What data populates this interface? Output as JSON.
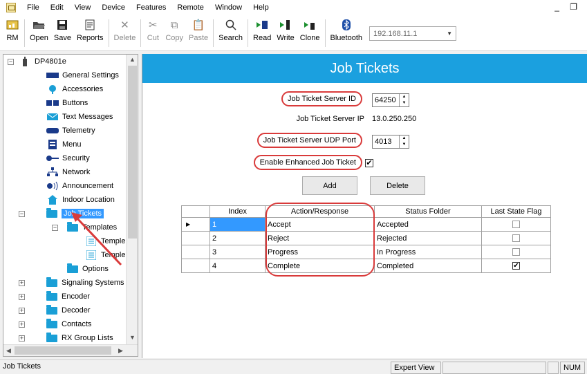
{
  "menu": [
    "File",
    "Edit",
    "View",
    "Device",
    "Features",
    "Remote",
    "Window",
    "Help"
  ],
  "window_controls": "_ ❐",
  "toolbar": {
    "buttons": [
      {
        "label": "RM",
        "icon": "rm-icon"
      },
      {
        "label": "Open",
        "icon": "open-folder-icon"
      },
      {
        "label": "Save",
        "icon": "save-icon"
      },
      {
        "label": "Reports",
        "icon": "reports-icon"
      },
      {
        "label": "Delete",
        "icon": "delete-icon",
        "disabled": true
      },
      {
        "label": "Cut",
        "icon": "cut-icon",
        "disabled": true
      },
      {
        "label": "Copy",
        "icon": "copy-icon",
        "disabled": true
      },
      {
        "label": "Paste",
        "icon": "paste-icon",
        "disabled": true
      },
      {
        "label": "Search",
        "icon": "search-icon"
      },
      {
        "label": "Read",
        "icon": "read-icon"
      },
      {
        "label": "Write",
        "icon": "write-icon"
      },
      {
        "label": "Clone",
        "icon": "clone-icon"
      },
      {
        "label": "Bluetooth",
        "icon": "bluetooth-icon"
      }
    ],
    "ip_address": "192.168.11.1"
  },
  "tree": {
    "root": "DP4801e",
    "items": {
      "general_settings": "General Settings",
      "accessories": "Accessories",
      "buttons": "Buttons",
      "text_messages": "Text Messages",
      "telemetry": "Telemetry",
      "menu": "Menu",
      "security": "Security",
      "network": "Network",
      "announcement": "Announcement",
      "indoor_location": "Indoor Location",
      "job_tickets": "Job Tickets",
      "templates": "Templates",
      "template_1": "Temple",
      "template_2": "Temple",
      "options": "Options",
      "signaling_systems": "Signaling Systems",
      "encoder": "Encoder",
      "decoder": "Decoder",
      "contacts": "Contacts",
      "rx_group_lists": "RX Group Lists"
    }
  },
  "main": {
    "title": "Job Tickets",
    "server_id_label": "Job Ticket Server ID",
    "server_id_value": "64250",
    "server_ip_label": "Job Ticket Server IP",
    "server_ip_value": "13.0.250.250",
    "udp_port_label": "Job Ticket Server UDP Port",
    "udp_port_value": "4013",
    "enhanced_label": "Enable Enhanced Job Ticket",
    "enhanced_checked": true,
    "add_label": "Add",
    "delete_label": "Delete",
    "table": {
      "headers": [
        "Index",
        "Action/Response",
        "Status Folder",
        "Last State Flag"
      ],
      "rows": [
        {
          "index": "1",
          "action": "Accept",
          "status": "Accepted",
          "flag": false
        },
        {
          "index": "2",
          "action": "Reject",
          "status": "Rejected",
          "flag": false
        },
        {
          "index": "3",
          "action": "Progress",
          "status": "In Progress",
          "flag": false
        },
        {
          "index": "4",
          "action": "Complete",
          "status": "Completed",
          "flag": true
        }
      ]
    }
  },
  "statusbar": {
    "left": "Job Tickets",
    "view": "Expert View",
    "num": "NUM"
  },
  "colors": {
    "banner": "#1ba0df",
    "annotation": "#d93a3a",
    "selection": "#3399ff"
  }
}
